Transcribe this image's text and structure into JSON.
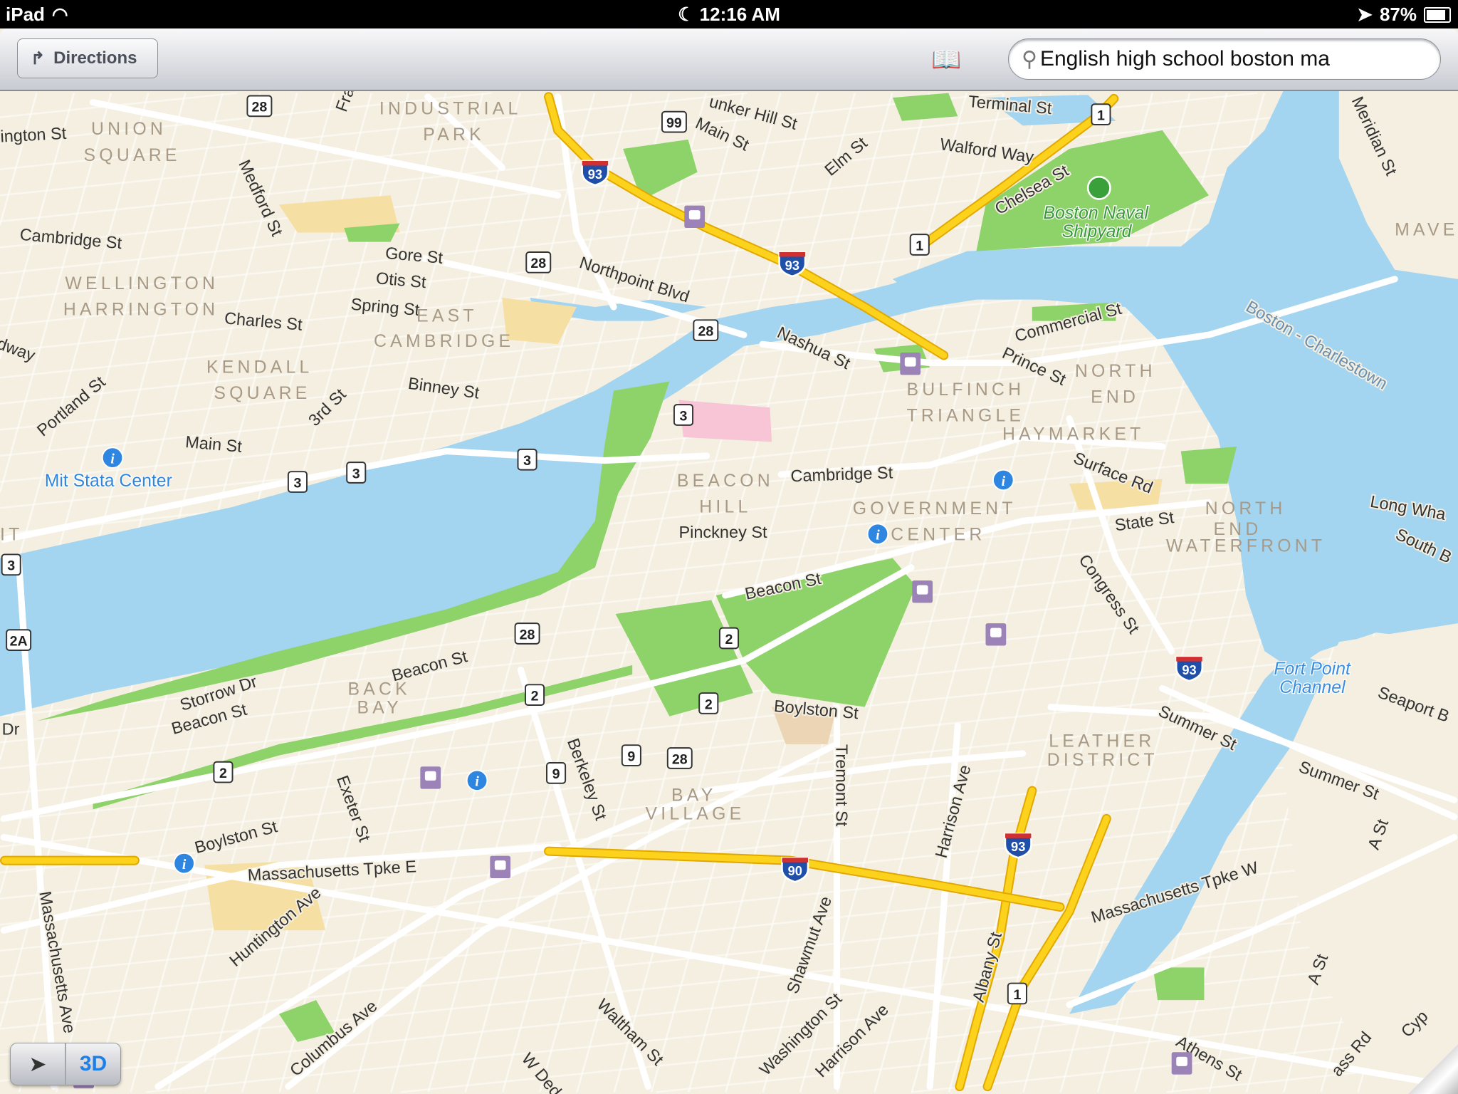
{
  "status_bar": {
    "device": "iPad",
    "time": "12:16 AM",
    "battery": "87%",
    "battery_level": 0.87
  },
  "toolbar": {
    "directions_label": "Directions",
    "search_value": "English high school boston ma",
    "icons": {
      "directions": "turn-right-arrow-icon",
      "bookmarks": "bookmarks-book-icon",
      "search": "magnifier-icon"
    }
  },
  "controls": {
    "location_icon": "location-arrow-icon",
    "three_d_label": "3D"
  },
  "colors": {
    "land": "#f4efe0",
    "water": "#a3d4f0",
    "park": "#8ed26a",
    "highway": "#fcd21c",
    "transit": "#9b83b8",
    "info": "#2f86e0"
  },
  "map": {
    "streets": [
      "ington St",
      "Cambridge St",
      "Medford St",
      "Gore St",
      "Otis St",
      "Spring St",
      "Charles St",
      "Northpoint Blvd",
      "Main St",
      "unker Hill St",
      "Elm St",
      "Walford Way",
      "Terminal St",
      "Chelsea St",
      "Meridian St",
      "Nashua St",
      "Commercial St",
      "Prince St",
      "Binney St",
      "Portland St",
      "3rd St",
      "Main St",
      "Cambridge St",
      "Pinckney St",
      "Surface Rd",
      "State St",
      "Congress St",
      "Beacon St",
      "Storrow Dr",
      "Beacon St",
      "Beacon St",
      "Boylston St",
      "Berkeley St",
      "Tremont St",
      "Harrison Ave",
      "Exeter St",
      "Boylston St",
      "Massachusetts Tpke E",
      "Huntington Ave",
      "Massachusetts Ave",
      "Columbus Ave",
      "Shawmut Ave",
      "Albany St",
      "Summer St",
      "Summer St",
      "Seaport B",
      "Massachusetts Tpke W",
      "A St",
      "A St",
      "Waltham St",
      "W Ded",
      "Washington St",
      "Harrison Ave",
      "Athens St",
      "Cyp",
      "ass Rd",
      "Long Wha",
      "South B",
      "Boston - Charlestown",
      "Dr",
      "dway",
      "Fra"
    ],
    "neighborhoods": [
      "UNION",
      "SQUARE",
      "INDUSTRIAL",
      "PARK",
      "WELLINGTON",
      "HARRINGTON",
      "EAST",
      "CAMBRIDGE",
      "KENDALL",
      "SQUARE",
      "BULFINCH",
      "TRIANGLE",
      "NORTH",
      "END",
      "HAYMARKET",
      "BEACON",
      "HILL",
      "GOVERNMENT",
      "CENTER",
      "NORTH",
      "END",
      "WATERFRONT",
      "BACK",
      "BAY",
      "BAY",
      "VILLAGE",
      "LEATHER",
      "DISTRICT",
      "MAVE",
      "IT"
    ],
    "pois": [
      "Mit Stata Center",
      "Boston Naval",
      "Shipyard",
      "Fort Point",
      "Channel"
    ],
    "route_shields": [
      "28",
      "28",
      "28",
      "28",
      "28",
      "99",
      "3",
      "3",
      "3",
      "3",
      "3",
      "2",
      "2",
      "2",
      "2",
      "9",
      "9",
      "2A",
      "1",
      "1",
      "1"
    ],
    "interstate_shields": [
      "93",
      "93",
      "93",
      "93",
      "90"
    ]
  }
}
